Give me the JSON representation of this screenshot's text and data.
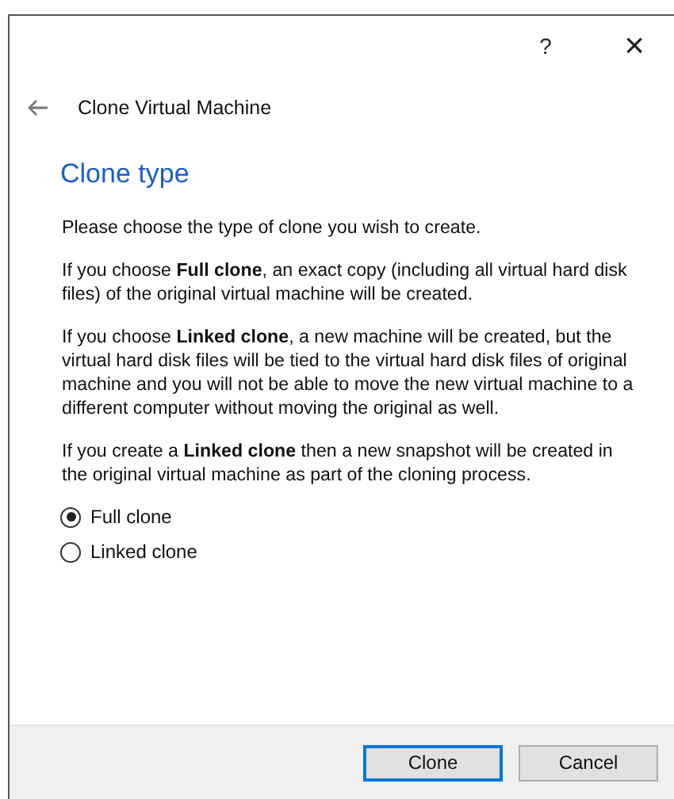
{
  "title_bar": {
    "help": "?",
    "close": "×"
  },
  "wizard": {
    "title": "Clone Virtual Machine",
    "page_title": "Clone type"
  },
  "paragraphs": [
    "Please choose the type of clone you wish to create.",
    "If you choose **Full clone**, an exact copy (including all virtual hard disk files) of the original virtual machine will be created.",
    "If you choose **Linked clone**, a new machine will be created, but the virtual hard disk files will be tied to the virtual hard disk files of original machine and you will not be able to move the new virtual machine to a different computer without moving the original as well.",
    "If you create a **Linked clone** then a new snapshot will be created in the original virtual machine as part of the cloning process."
  ],
  "options": [
    {
      "label": "Full clone",
      "selected": true
    },
    {
      "label": "Linked clone",
      "selected": false
    }
  ],
  "buttons": [
    {
      "label": "Clone",
      "default": true
    },
    {
      "label": "Cancel",
      "default": false
    }
  ]
}
